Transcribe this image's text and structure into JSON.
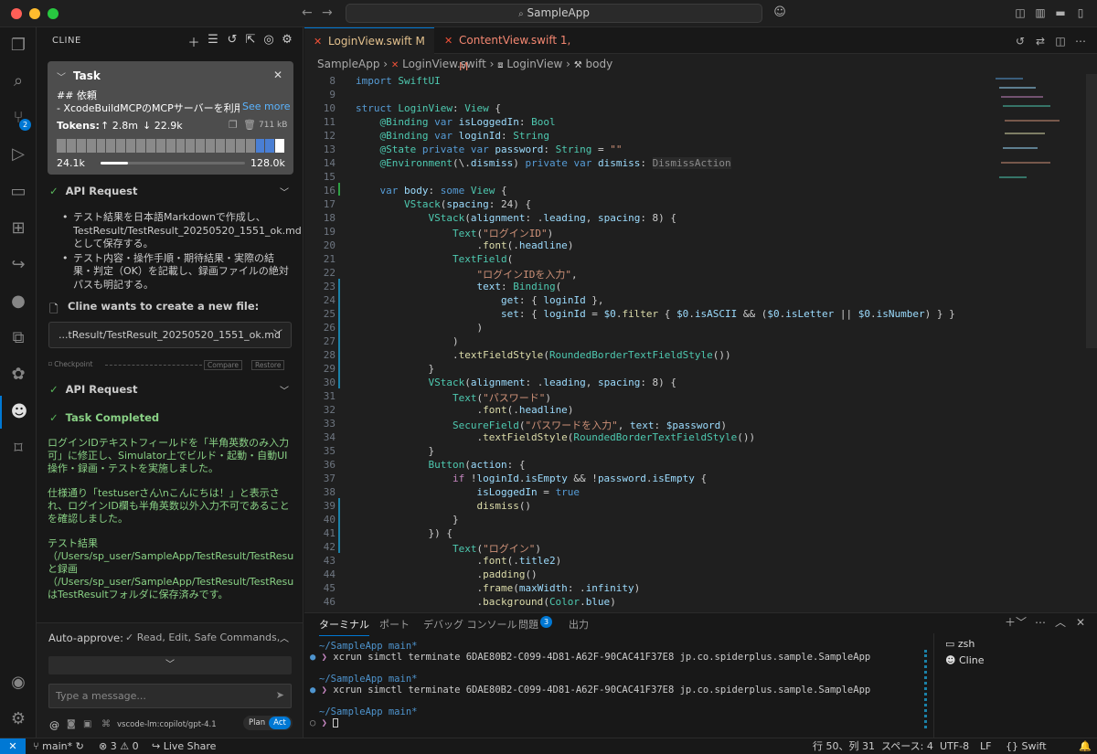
{
  "title": {
    "command_center": "SampleApp"
  },
  "sidebar": {
    "title": "CLINE",
    "task": {
      "label": "Task",
      "heading": "## 依頼",
      "desc": "- XcodeBuildMCPのMCPサーバーを利用",
      "see_more": "See more",
      "tokens_label": "Tokens:",
      "tokens_up": "2.8m",
      "tokens_down": "22.9k",
      "size": "711 kB",
      "ctx_used": "24.1k",
      "ctx_max": "128.0k",
      "ctx_fraction": 0.19
    },
    "api_request_1": "API Request",
    "bullets": [
      "テスト結果を日本語Markdownで作成し、TestResult/TestResult_20250520_1551_ok.mdとして保存する。",
      "テスト内容・操作手順・期待結果・実際の結果・判定（OK）を記載し、録画ファイルの絶対パスも明記する。"
    ],
    "newfile_label": "Cline wants to create a new file:",
    "newfile_path": "...tResult/TestResult_20250520_1551_ok.md",
    "checkpoint": "Checkpoint",
    "compare": "Compare",
    "restore": "Restore",
    "api_request_2": "API Request",
    "task_completed": "Task Completed",
    "result_paras": [
      "ログインIDテキストフィールドを「半角英数のみ入力可」に修正し、Simulator上でビルド・起動・自動UI操作・録画・テストを実施しました。",
      "仕様通り「testuserさん\\nこんにちは！」と表示され、ログインID欄も半角英数以外入力不可であることを確認しました。",
      "テスト結果（/Users/sp_user/SampleApp/TestResult/TestResult_20250520_1551_ok.md）と録画（/Users/sp_user/SampleApp/TestResult/TestResult_20250520_1550_fix5.mp4）はTestResultフォルダに保存済みです。"
    ],
    "auto_approve_label": "Auto-approve:",
    "auto_approve_value": "✓ Read, Edit, Safe Commands,",
    "message_placeholder": "Type a message...",
    "model": "vscode-lm:copilot/gpt-4.1",
    "plan": "Plan",
    "act": "Act"
  },
  "editor": {
    "tabs": [
      {
        "label": "LoginView.swift",
        "status": "M"
      },
      {
        "label": "ContentView.swift",
        "status": "1, M"
      }
    ],
    "breadcrumb": [
      "SampleApp",
      "LoginView.swift",
      "LoginView",
      "body"
    ],
    "line_numbers": [
      "8",
      "9",
      "10",
      "11",
      "12",
      "13",
      "14",
      "15",
      "16",
      "17",
      "18",
      "19",
      "20",
      "21",
      "22",
      "23",
      "24",
      "25",
      "26",
      "27",
      "28",
      "29",
      "30",
      "31",
      "32",
      "33",
      "34",
      "35",
      "36",
      "37",
      "38",
      "39",
      "40",
      "41",
      "42",
      "43",
      "44",
      "45",
      "46"
    ],
    "inlay_hint": "DismissAction"
  },
  "panel": {
    "tabs": [
      "ターミナル",
      "ポート",
      "デバッグ コンソール",
      "問題",
      "出力"
    ],
    "problems_count": "3",
    "terminal_lines": [
      {
        "type": "prompt",
        "text": "~/SampleApp main*"
      },
      {
        "type": "cmd",
        "text": "xcrun simctl terminate 6DAE80B2-C099-4D81-A62F-90CAC41F37E8 jp.co.spiderplus.sample.SampleApp"
      },
      {
        "type": "blank",
        "text": ""
      },
      {
        "type": "prompt",
        "text": "~/SampleApp main*"
      },
      {
        "type": "cmd",
        "text": "xcrun simctl terminate 6DAE80B2-C099-4D81-A62F-90CAC41F37E8 jp.co.spiderplus.sample.SampleApp"
      },
      {
        "type": "blank",
        "text": ""
      },
      {
        "type": "prompt",
        "text": "~/SampleApp main*"
      },
      {
        "type": "cursor",
        "text": ""
      }
    ],
    "sessions": [
      "zsh",
      "Cline"
    ]
  },
  "status": {
    "branch": "main*",
    "errors": "3",
    "warnings": "0",
    "live_share": "Live Share",
    "position": "行 50、列 31",
    "spaces": "スペース: 4",
    "encoding": "UTF-8",
    "eol": "LF",
    "language": "Swift"
  },
  "colors": {
    "accent": "#0078d4",
    "success": "#89d185",
    "swift": "#f05138"
  }
}
